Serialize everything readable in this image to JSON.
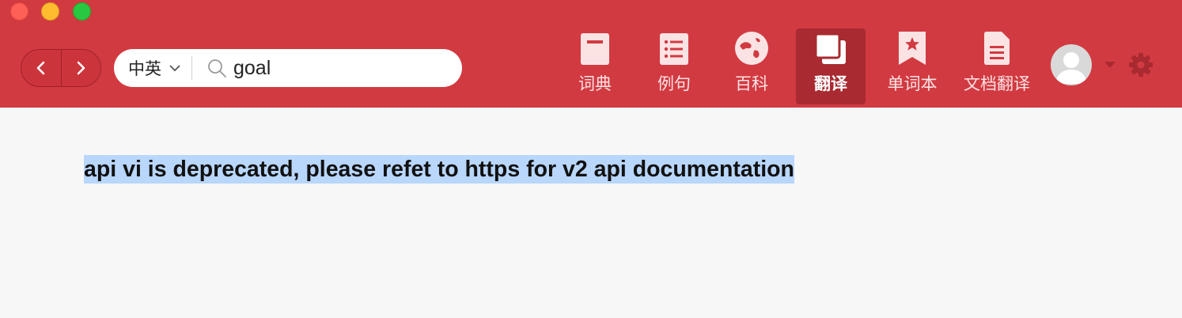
{
  "window": {
    "controls": [
      "close",
      "minimize",
      "maximize"
    ]
  },
  "toolbar": {
    "back_icon": "chevron-left-icon",
    "forward_icon": "chevron-right-icon",
    "search": {
      "language": "中英",
      "query": "goal"
    },
    "tools": [
      {
        "label": "词典",
        "icon": "dictionary-icon",
        "active": false
      },
      {
        "label": "例句",
        "icon": "list-icon",
        "active": false
      },
      {
        "label": "百科",
        "icon": "globe-icon",
        "active": false
      },
      {
        "label": "翻译",
        "icon": "translate-icon",
        "active": true
      },
      {
        "label": "单词本",
        "icon": "wordbook-icon",
        "active": false
      },
      {
        "label": "文档翻译",
        "icon": "document-icon",
        "active": false
      }
    ],
    "avatar_icon": "user-avatar-icon",
    "settings_icon": "gear-icon"
  },
  "colors": {
    "header_bg": "#d23a41",
    "active_tab_bg": "#a92a30",
    "selection_bg": "#b9d6fb",
    "content_bg": "#f7f7f7"
  },
  "content": {
    "message": "api vi is deprecated, please refet to https for v2 api documentation"
  }
}
